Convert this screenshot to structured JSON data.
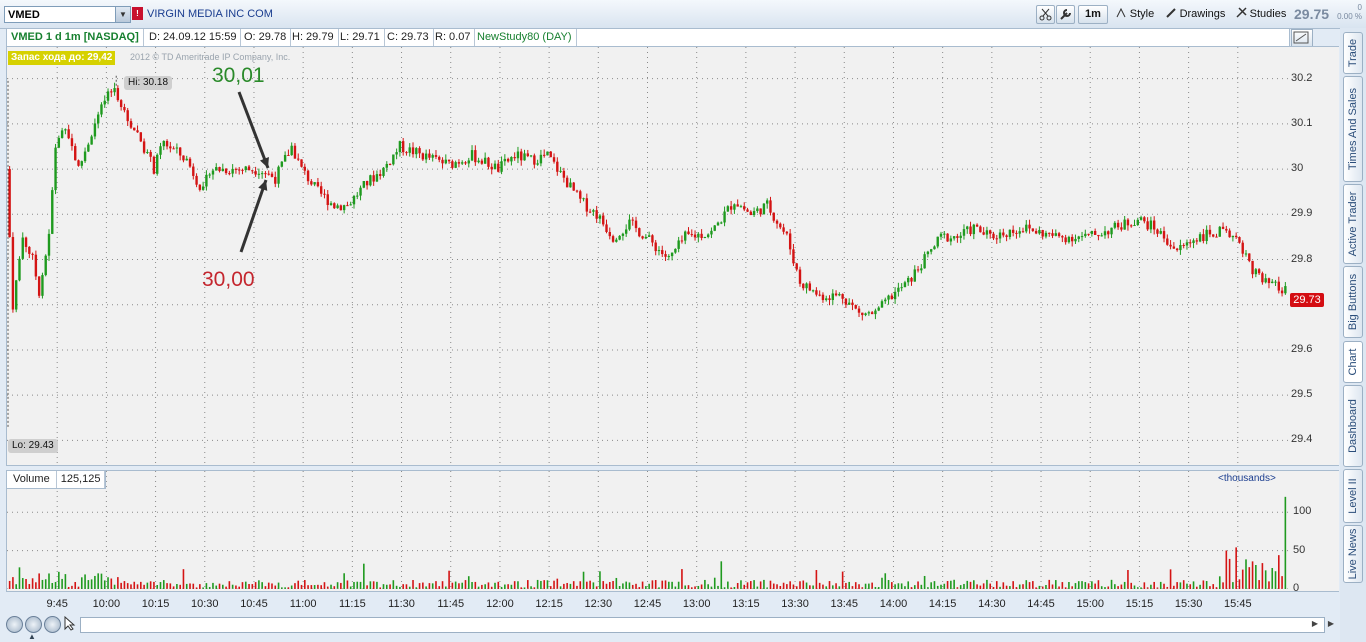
{
  "toolbar": {
    "symbol": "VMED",
    "company": "VIRGIN MEDIA INC COM",
    "flag_label": "!",
    "aggregation": "1m",
    "style_label": "Style",
    "drawings_label": "Drawings",
    "studies_label": "Studies",
    "last_price": "29.75",
    "change_top": "0",
    "change_pct": "0.00 %"
  },
  "infobar": {
    "title": "VMED 1 d 1m [NASDAQ]",
    "date": "D: 24.09.12 15:59",
    "open": "O: 29.78",
    "high": "H: 29.79",
    "low": "L: 29.71",
    "close": "C: 29.73",
    "range": "R: 0.07",
    "study": "NewStudy80 (DAY)"
  },
  "chart": {
    "reserve_label": "Запас хода до: 29,42",
    "copyright": "2012 © TD Ameritrade IP Company, Inc.",
    "hi_label": "Hi: 30.18",
    "lo_label": "Lo: 29.43",
    "annotation_green": "30,01",
    "annotation_red": "30,00",
    "current_price": "29.73",
    "y_ticks": [
      "30.2",
      "30.1",
      "30",
      "29.9",
      "29.8",
      "29.7",
      "29.6",
      "29.5",
      "29.4"
    ],
    "x_ticks": [
      "9:45",
      "10:00",
      "10:15",
      "10:30",
      "10:45",
      "11:00",
      "11:15",
      "11:30",
      "11:45",
      "12:00",
      "12:15",
      "12:30",
      "12:45",
      "13:00",
      "13:15",
      "13:30",
      "13:45",
      "14:00",
      "14:15",
      "14:30",
      "14:45",
      "15:00",
      "15:15",
      "15:30",
      "15:45"
    ],
    "up_color": "#1f9a1f",
    "down_color": "#d41414"
  },
  "volume": {
    "label": "Volume",
    "value": "125,125",
    "units": "<thousands>",
    "y_ticks": [
      "100",
      "50",
      "0"
    ]
  },
  "sidetabs": [
    "Trade",
    "Times And Sales",
    "Active Trader",
    "Big Buttons",
    "Chart",
    "Dashboard",
    "Level II",
    "Live News"
  ],
  "chart_data": {
    "type": "candlestick",
    "ylim": [
      29.35,
      30.27
    ],
    "x_start": "9:30",
    "x_end": "16:00",
    "anchors": [
      [
        "9:30",
        30.0
      ],
      [
        "9:32",
        29.7
      ],
      [
        "9:35",
        29.85
      ],
      [
        "9:38",
        29.8
      ],
      [
        "9:40",
        29.73
      ],
      [
        "9:43",
        29.85
      ],
      [
        "9:45",
        30.05
      ],
      [
        "9:48",
        30.1
      ],
      [
        "9:52",
        30.0
      ],
      [
        "9:57",
        30.1
      ],
      [
        "10:00",
        30.15
      ],
      [
        "10:03",
        30.18
      ],
      [
        "10:06",
        30.12
      ],
      [
        "10:10",
        30.08
      ],
      [
        "10:15",
        30.0
      ],
      [
        "10:18",
        30.06
      ],
      [
        "10:25",
        30.02
      ],
      [
        "10:30",
        29.95
      ],
      [
        "10:32",
        30.0
      ],
      [
        "10:40",
        30.0
      ],
      [
        "10:47",
        30.0
      ],
      [
        "10:52",
        29.98
      ],
      [
        "10:57",
        30.05
      ],
      [
        "11:00",
        30.0
      ],
      [
        "11:05",
        29.95
      ],
      [
        "11:10",
        29.92
      ],
      [
        "11:14",
        29.92
      ],
      [
        "11:20",
        29.97
      ],
      [
        "11:25",
        30.0
      ],
      [
        "11:30",
        30.05
      ],
      [
        "11:37",
        30.03
      ],
      [
        "11:45",
        30.01
      ],
      [
        "11:52",
        30.03
      ],
      [
        "12:00",
        30.0
      ],
      [
        "12:05",
        30.03
      ],
      [
        "12:10",
        30.02
      ],
      [
        "12:15",
        30.03
      ],
      [
        "12:20",
        29.98
      ],
      [
        "12:25",
        29.93
      ],
      [
        "12:30",
        29.9
      ],
      [
        "12:35",
        29.85
      ],
      [
        "12:40",
        29.88
      ],
      [
        "12:45",
        29.85
      ],
      [
        "12:52",
        29.8
      ],
      [
        "12:57",
        29.85
      ],
      [
        "13:05",
        29.86
      ],
      [
        "13:12",
        29.93
      ],
      [
        "13:17",
        29.9
      ],
      [
        "13:22",
        29.92
      ],
      [
        "13:28",
        29.85
      ],
      [
        "13:32",
        29.75
      ],
      [
        "13:38",
        29.72
      ],
      [
        "13:45",
        29.72
      ],
      [
        "13:50",
        29.68
      ],
      [
        "13:55",
        29.68
      ],
      [
        "14:00",
        29.72
      ],
      [
        "14:05",
        29.75
      ],
      [
        "14:10",
        29.8
      ],
      [
        "14:15",
        29.85
      ],
      [
        "14:20",
        29.85
      ],
      [
        "14:25",
        29.87
      ],
      [
        "14:30",
        29.85
      ],
      [
        "14:40",
        29.87
      ],
      [
        "14:50",
        29.85
      ],
      [
        "15:00",
        29.85
      ],
      [
        "15:08",
        29.87
      ],
      [
        "15:15",
        29.89
      ],
      [
        "15:20",
        29.87
      ],
      [
        "15:27",
        29.82
      ],
      [
        "15:33",
        29.85
      ],
      [
        "15:40",
        29.86
      ],
      [
        "15:45",
        29.85
      ],
      [
        "15:50",
        29.78
      ],
      [
        "15:53",
        29.75
      ],
      [
        "16:00",
        29.73
      ]
    ],
    "hi": 30.18,
    "lo": 29.43,
    "last": 29.73,
    "volume_ylim": [
      0,
      125
    ]
  }
}
